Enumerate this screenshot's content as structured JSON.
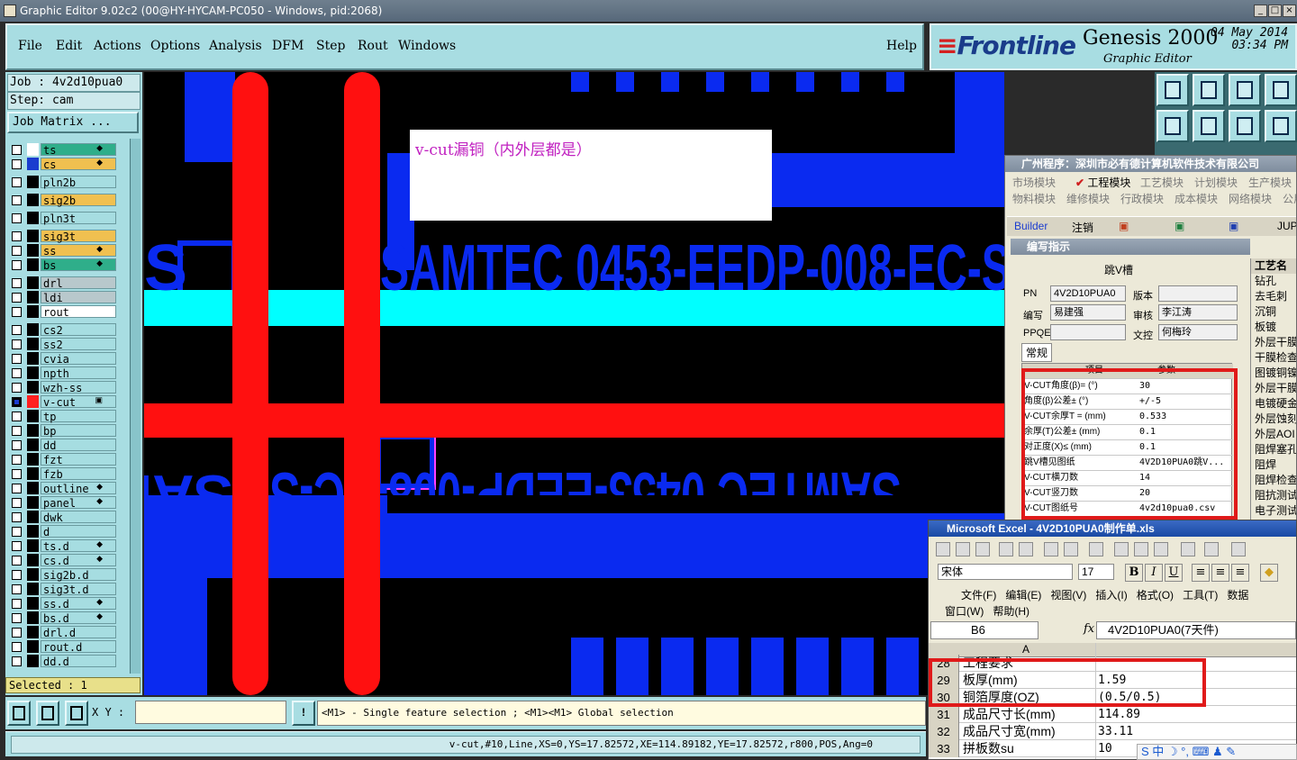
{
  "window": {
    "title": "Graphic Editor 9.02c2 (00@HY-HYCAM-PC050 - Windows, pid:2068)"
  },
  "menu": [
    "File",
    "Edit",
    "Actions",
    "Options",
    "Analysis",
    "DFM",
    "Step",
    "Rout",
    "Windows"
  ],
  "help": "Help",
  "brand": {
    "logo": "Frontline",
    "product": "Genesis 2000",
    "subtitle": "Graphic Editor",
    "date": "04 May 2014",
    "time": "03:34 PM"
  },
  "job": {
    "job_line": "Job : 4v2d10pua0",
    "step_line": "Step: cam",
    "matrix_button": "Job Matrix ..."
  },
  "layers": [
    {
      "name": "ts",
      "color": "#2fae8a",
      "flag": "◆",
      "layer_bg": "#ffffff"
    },
    {
      "name": "cs",
      "color": "#f0c050",
      "flag": "◆",
      "layer_bg": "#1a3ccf"
    },
    {
      "name": "pln2b",
      "color": "#a6dde1",
      "flag": "",
      "layer_bg": "#000000"
    },
    {
      "name": "sig2b",
      "color": "#f0c050",
      "flag": "",
      "layer_bg": "#000000"
    },
    {
      "name": "pln3t",
      "color": "#a6dde1",
      "flag": "",
      "layer_bg": "#000000"
    },
    {
      "name": "sig3t",
      "color": "#f0c050",
      "flag": "",
      "layer_bg": "#000000"
    },
    {
      "name": "ss",
      "color": "#f0c050",
      "flag": "◆",
      "layer_bg": "#000000"
    },
    {
      "name": "bs",
      "color": "#2fae8a",
      "flag": "◆",
      "layer_bg": "#000000"
    },
    {
      "name": "drl",
      "color": "#b8c8cc",
      "flag": "",
      "layer_bg": "#000000"
    },
    {
      "name": "ldi",
      "color": "#b8c8cc",
      "flag": "",
      "layer_bg": "#000000"
    },
    {
      "name": "rout",
      "color": "#ffffff",
      "flag": "",
      "layer_bg": "#000000"
    },
    {
      "name": "cs2",
      "color": "#a6dde1",
      "flag": "",
      "layer_bg": "#000000"
    },
    {
      "name": "ss2",
      "color": "#a6dde1",
      "flag": "",
      "layer_bg": "#000000"
    },
    {
      "name": "cvia",
      "color": "#a6dde1",
      "flag": "",
      "layer_bg": "#000000"
    },
    {
      "name": "npth",
      "color": "#a6dde1",
      "flag": "",
      "layer_bg": "#000000"
    },
    {
      "name": "wzh-ss",
      "color": "#a6dde1",
      "flag": "",
      "layer_bg": "#000000"
    },
    {
      "name": "v-cut",
      "color": "#a6dde1",
      "flag": "▣",
      "layer_bg": "#ff2020",
      "active": true
    },
    {
      "name": "tp",
      "color": "#a6dde1",
      "flag": "",
      "layer_bg": "#000000"
    },
    {
      "name": "bp",
      "color": "#a6dde1",
      "flag": "",
      "layer_bg": "#000000"
    },
    {
      "name": "dd",
      "color": "#a6dde1",
      "flag": "",
      "layer_bg": "#000000"
    },
    {
      "name": "fzt",
      "color": "#a6dde1",
      "flag": "",
      "layer_bg": "#000000"
    },
    {
      "name": "fzb",
      "color": "#a6dde1",
      "flag": "",
      "layer_bg": "#000000"
    },
    {
      "name": "outline",
      "color": "#a6dde1",
      "flag": "◆",
      "layer_bg": "#000000"
    },
    {
      "name": "panel",
      "color": "#a6dde1",
      "flag": "◆",
      "layer_bg": "#000000"
    },
    {
      "name": "dwk",
      "color": "#a6dde1",
      "flag": "",
      "layer_bg": "#000000"
    },
    {
      "name": "d",
      "color": "#a6dde1",
      "flag": "",
      "layer_bg": "#000000"
    },
    {
      "name": "ts.d",
      "color": "#a6dde1",
      "flag": "◆",
      "layer_bg": "#000000"
    },
    {
      "name": "cs.d",
      "color": "#a6dde1",
      "flag": "◆",
      "layer_bg": "#000000"
    },
    {
      "name": "sig2b.d",
      "color": "#a6dde1",
      "flag": "",
      "layer_bg": "#000000"
    },
    {
      "name": "sig3t.d",
      "color": "#a6dde1",
      "flag": "",
      "layer_bg": "#000000"
    },
    {
      "name": "ss.d",
      "color": "#a6dde1",
      "flag": "◆",
      "layer_bg": "#000000"
    },
    {
      "name": "bs.d",
      "color": "#a6dde1",
      "flag": "◆",
      "layer_bg": "#000000"
    },
    {
      "name": "drl.d",
      "color": "#a6dde1",
      "flag": "",
      "layer_bg": "#000000"
    },
    {
      "name": "rout.d",
      "color": "#a6dde1",
      "flag": "",
      "layer_bg": "#000000"
    },
    {
      "name": "dd.d",
      "color": "#a6dde1",
      "flag": "",
      "layer_bg": "#000000"
    }
  ],
  "selected": "Selected : 1",
  "canvas": {
    "annotation": "v-cut漏铜（内外层都是）",
    "text_top": "SAMTEC  0453-EEDP-008-EC-S",
    "text_bottom": "SAMTEC  0453-EEDP-008-EC-S",
    "colors": {
      "copper": "#0a2af0",
      "vcut": "#ff1010",
      "highlight": "#00ffff",
      "pink": "#ff40ff"
    }
  },
  "erp": {
    "title": "广州程序：深圳市必有德计算机软件技术有限公司",
    "modules_row1": [
      "市场模块",
      "工程模块",
      "工艺模块",
      "计划模块",
      "生产模块"
    ],
    "modules_row2": [
      "物料模块",
      "维修模块",
      "行政模块",
      "成本模块",
      "网络模块",
      "公用"
    ],
    "toolbar": [
      "Builder",
      "注销",
      "JUP"
    ],
    "subwin_title": "编写指示",
    "header": "跳V槽",
    "fields": {
      "pn_label": "PN",
      "pn": "4V2D10PUA0",
      "version_label": "版本",
      "version": "",
      "author_label": "编写",
      "author": "易建强",
      "review_label": "审核",
      "review": "李江涛",
      "ppqe_label": "PPQE",
      "ppqe": "",
      "doc_label": "文控",
      "doc": "何梅玲"
    },
    "tab": "常规",
    "table_headers": [
      "项目",
      "参数"
    ],
    "params": [
      [
        "V-CUT角度(β)=  (°)",
        "30"
      ],
      [
        "角度(β)公差±  (°)",
        "+/-5"
      ],
      [
        "V-CUT余厚T =  (mm)",
        "0.533"
      ],
      [
        "余厚(T)公差±  (mm)",
        "0.1"
      ],
      [
        "对正度(X)≤  (mm)",
        "0.1"
      ],
      [
        "跳V槽见图纸",
        "4V2D10PUA0跳V..."
      ],
      [
        "V-CUT横刀数",
        "14"
      ],
      [
        "V-CUT竖刀数",
        "20"
      ],
      [
        "V-CUT图纸号",
        "4v2d10pua0.csv"
      ]
    ],
    "process_header": "工艺名",
    "processes": [
      "钻孔",
      "去毛刺",
      "沉铜",
      "板镀",
      "外层干膜",
      "干膜检查",
      "图镀铜镍",
      "外层干膜",
      "电镀硬金",
      "外层蚀刻",
      "外层AOI",
      "阻焊塞孔",
      "阻焊",
      "阻焊检查",
      "阻抗测试",
      "电子测试"
    ]
  },
  "excel": {
    "title": "Microsoft Excel - 4V2D10PUA0制作单.xls",
    "font": "宋体",
    "size": "17",
    "menu1": [
      "文件(F)",
      "编辑(E)",
      "视图(V)",
      "插入(I)",
      "格式(O)",
      "工具(T)",
      "数据"
    ],
    "menu2": [
      "窗口(W)",
      "帮助(H)"
    ],
    "cell_ref": "B6",
    "formula": "4V2D10PUA0(7天件)",
    "col_a": "A",
    "rows": [
      {
        "n": "28",
        "a": "工程要求",
        "b": ""
      },
      {
        "n": "29",
        "a": "板厚(mm)",
        "b": "1.59"
      },
      {
        "n": "30",
        "a": "铜箔厚度(OZ)",
        "b": "(0.5/0.5)"
      },
      {
        "n": "31",
        "a": "成品尺寸长(mm)",
        "b": "114.89"
      },
      {
        "n": "32",
        "a": "成品尺寸宽(mm)",
        "b": "33.11"
      },
      {
        "n": "33",
        "a": "拼板数su",
        "b": "10"
      }
    ]
  },
  "bottom": {
    "xy_label": "X Y :",
    "xy_value": "",
    "hint": "<M1> - Single feature selection ; <M1><M1> Global selection",
    "status": "v-cut,#10,Line,XS=0,YS=17.82572,XE=114.89182,YE=17.82572,r800,POS,Ang=0"
  },
  "ime": "S 中 ☽ °, ⌨ ♟ ✎"
}
